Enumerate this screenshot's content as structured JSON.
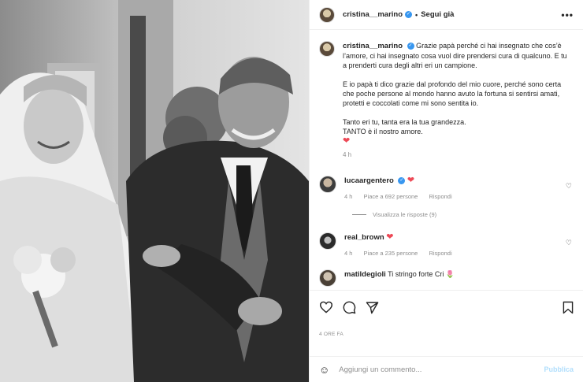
{
  "header": {
    "username": "cristina__marino",
    "separator": "•",
    "follow_label": "Segui già",
    "more": "•••"
  },
  "caption": {
    "username": "cristina__marino",
    "p1": "Grazie papà perché ci hai insegnato che cos’è l’amore, ci hai insegnato cosa vuol dire prendersi cura di qualcuno. E tu a prenderti cura degli altri eri un campione.",
    "p2": "E io papà ti dico grazie dal profondo del mio cuore, perché sono certa che poche persone al mondo hanno avuto la fortuna si sentirsi amati, protetti e coccolati come mi sono sentita io.",
    "p3a": "Tanto eri tu, tanta era la tua grandezza.",
    "p3b": "TANTO è il nostro amore.",
    "heart": "❤",
    "time": "4 h"
  },
  "comments": [
    {
      "username": "lucaargentero",
      "text": "❤",
      "time": "4 h",
      "likes": "Piace a 692 persone",
      "reply": "Rispondi",
      "view_replies": "Visualizza le risposte (9)"
    },
    {
      "username": "real_brown",
      "text": "❤",
      "time": "4 h",
      "likes": "Piace a 235 persone",
      "reply": "Rispondi"
    },
    {
      "username": "matildegioli",
      "text": "Ti stringo forte Cri 🌷"
    }
  ],
  "footer": {
    "time_ago": "4 ORE FA",
    "comment_placeholder": "Aggiungi un commento...",
    "publish_label": "Pubblica"
  }
}
